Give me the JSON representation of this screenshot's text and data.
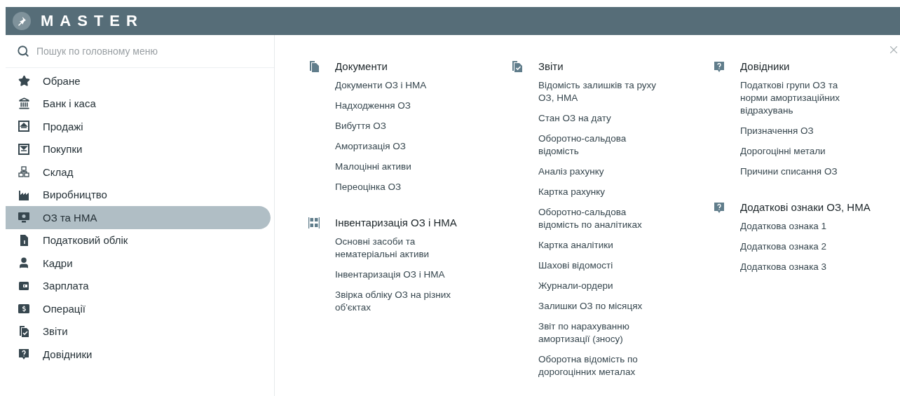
{
  "app": {
    "title": "MASTER"
  },
  "search": {
    "placeholder": "Пошук по головному меню"
  },
  "sidebar": {
    "items": [
      {
        "label": "Обране",
        "selected": false
      },
      {
        "label": "Банк і каса",
        "selected": false
      },
      {
        "label": "Продажі",
        "selected": false
      },
      {
        "label": "Покупки",
        "selected": false
      },
      {
        "label": "Склад",
        "selected": false
      },
      {
        "label": "Виробництво",
        "selected": false
      },
      {
        "label": "ОЗ та НМА",
        "selected": true
      },
      {
        "label": "Податковий облік",
        "selected": false
      },
      {
        "label": "Кадри",
        "selected": false
      },
      {
        "label": "Зарплата",
        "selected": false
      },
      {
        "label": "Операції",
        "selected": false
      },
      {
        "label": "Звіти",
        "selected": false
      },
      {
        "label": "Довідники",
        "selected": false
      }
    ]
  },
  "menu": {
    "columns": [
      {
        "sections": [
          {
            "title": "Документи",
            "items": [
              "Документи ОЗ і НМА",
              "Надходження ОЗ",
              "Вибуття ОЗ",
              "Амортизація ОЗ",
              "Малоцінні активи",
              "Переоцінка ОЗ"
            ]
          },
          {
            "title": "Інвентаризація ОЗ і НМА",
            "items": [
              "Основні засоби та нематеріальні активи",
              "Інвентаризація ОЗ і НМА",
              "Звірка обліку ОЗ на різних об'єктах"
            ]
          }
        ]
      },
      {
        "sections": [
          {
            "title": "Звіти",
            "items": [
              "Відомість залишків та руху ОЗ, НМА",
              "Стан ОЗ на дату",
              "Оборотно-сальдова відомість",
              "Аналіз рахунку",
              "Картка рахунку",
              "Оборотно-сальдова відомість по аналітиках",
              "Картка аналітики",
              "Шахові відомості",
              "Журнали-ордери",
              "Залишки ОЗ по місяцях",
              "Звіт по нарахуванню амортизації (зносу)",
              "Оборотна відомість по дорогоцінних металах"
            ]
          }
        ]
      },
      {
        "sections": [
          {
            "title": "Довідники",
            "items": [
              "Податкові групи ОЗ та норми амортизаційних відрахувань",
              "Призначення ОЗ",
              "Дорогоцінні метали",
              "Причини списання ОЗ"
            ]
          },
          {
            "title": "Додаткові ознаки ОЗ, НМА",
            "items": [
              "Додаткова ознака 1",
              "Додаткова ознака 2",
              "Додаткова ознака 3"
            ]
          }
        ]
      }
    ]
  }
}
